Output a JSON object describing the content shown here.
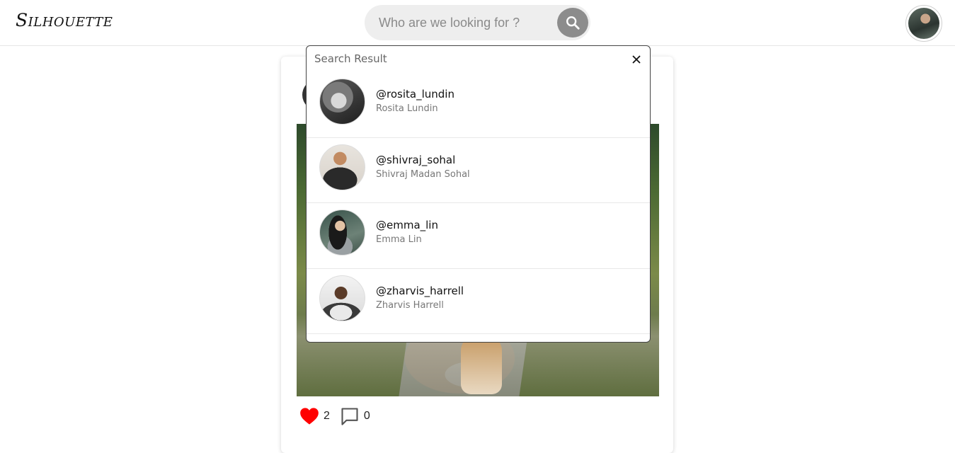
{
  "app": {
    "logo_text": "Silhouette"
  },
  "search": {
    "placeholder": "Who are we looking for ?",
    "value": ""
  },
  "results": {
    "title": "Search Result",
    "items": [
      {
        "username": "@rosita_lundin",
        "name": "Rosita Lundin"
      },
      {
        "username": "@shivraj_sohal",
        "name": "Shivraj Madan Sohal"
      },
      {
        "username": "@emma_lin",
        "name": "Emma Lin"
      },
      {
        "username": "@zharvis_harrell",
        "name": "Zharvis Harrell"
      }
    ]
  },
  "post": {
    "likes": "2",
    "comments": "0"
  },
  "colors": {
    "like_red": "#ff0000",
    "search_button": "#8c8c8c",
    "search_bg": "#eeeeee"
  },
  "icons": {
    "search": "search-icon",
    "close": "close-icon",
    "heart": "heart-icon",
    "comment": "comment-icon",
    "more": "more-vertical-icon"
  }
}
